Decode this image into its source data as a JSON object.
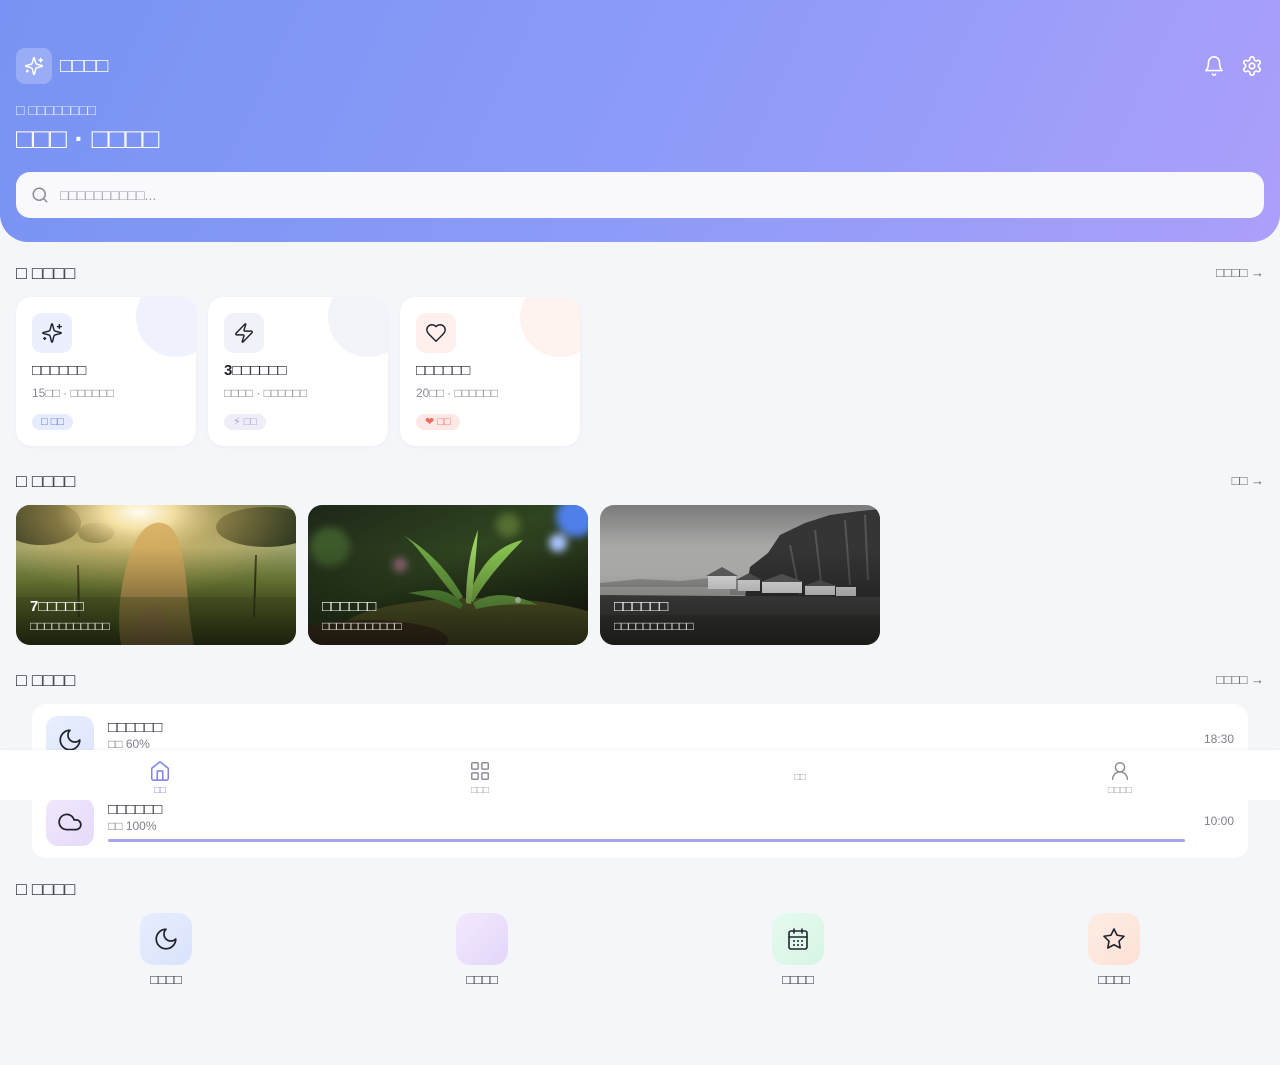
{
  "app": {
    "name": "□□□□"
  },
  "header": {
    "greeting": "□ □□□□□□□□",
    "title": "□□□ · □□□□"
  },
  "search": {
    "placeholder": "□□□□□□□□□□..."
  },
  "sections": {
    "featured": {
      "title": "□ □□□□",
      "link": "□□□□ →"
    },
    "gallery": {
      "title": "□ □□□□",
      "link": "□□ →"
    },
    "history": {
      "title": "□ □□□□",
      "link": "□□□□ →"
    },
    "quick": {
      "title": "□ □□□□"
    }
  },
  "cards": [
    {
      "icon": "sparkles-icon",
      "title": "□□□□□□",
      "subtitle": "15□□ · □□□□□□",
      "badge": "□ □□",
      "accent": "#4d6fe0"
    },
    {
      "icon": "lightning-icon",
      "title": "3□□□□□□",
      "subtitle": "□□□□ · □□□□□□",
      "badge": "⚡ □□",
      "accent": "#a39fd8"
    },
    {
      "icon": "heart-icon",
      "title": "□□□□□□",
      "subtitle": "20□□ · □□□□□□",
      "badge": "❤ □□",
      "accent": "#ee6a5e"
    }
  ],
  "gallery": [
    {
      "title": "7□□□□□",
      "subtitle": "□□□□□□□□□□□"
    },
    {
      "title": "□□□□□□",
      "subtitle": "□□□□□□□□□□□"
    },
    {
      "title": "□□□□□□",
      "subtitle": "□□□□□□□□□□□"
    }
  ],
  "history": [
    {
      "icon": "moon-icon",
      "title": "□□□□□□",
      "status": "□□ 60%",
      "progress": 0.6,
      "time": "18:30"
    },
    {
      "icon": "cloud-icon",
      "title": "□□□□□□",
      "status": "□□ 100%",
      "progress": 1.0,
      "time": "10:00"
    }
  ],
  "quick_actions": [
    {
      "icon": "moon-icon",
      "label": "□□□□"
    },
    {
      "icon": "",
      "label": "□□□□"
    },
    {
      "icon": "calendar-icon",
      "label": "□□□□"
    },
    {
      "icon": "star-icon",
      "label": "□□□□"
    }
  ],
  "bottom_nav": [
    {
      "icon": "home-icon",
      "label": "□□",
      "active": true
    },
    {
      "icon": "grid-icon",
      "label": "□□□",
      "active": false
    },
    {
      "icon": "",
      "label": "□□",
      "active": false
    },
    {
      "icon": "user-icon",
      "label": "□□□□",
      "active": false
    }
  ],
  "colors": {
    "header_start": "#7893f3",
    "header_end": "#ab9ffb",
    "accent": "#7a80e6",
    "page_bg": "#f5f6fa"
  }
}
